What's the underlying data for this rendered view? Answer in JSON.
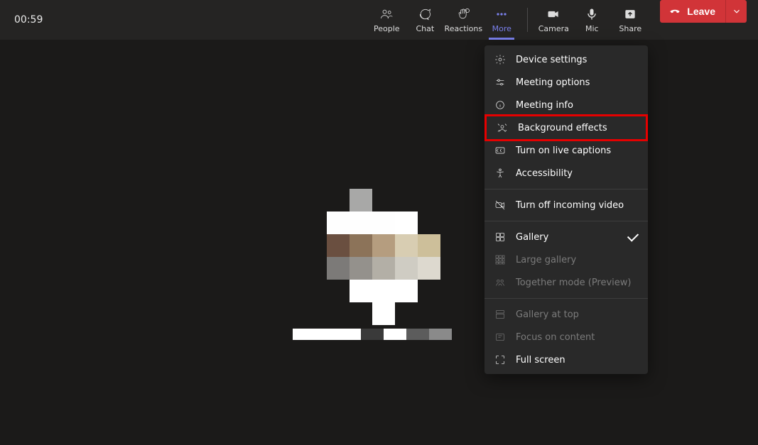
{
  "timer": "00:59",
  "toolbar": {
    "people": "People",
    "chat": "Chat",
    "reactions": "Reactions",
    "more": "More",
    "camera": "Camera",
    "mic": "Mic",
    "share": "Share"
  },
  "leave": {
    "label": "Leave"
  },
  "menu": {
    "device_settings": "Device settings",
    "meeting_options": "Meeting options",
    "meeting_info": "Meeting info",
    "background_effects": "Background effects",
    "live_captions": "Turn on live captions",
    "accessibility": "Accessibility",
    "incoming_video_off": "Turn off incoming video",
    "gallery": "Gallery",
    "large_gallery": "Large gallery",
    "together_mode": "Together mode (Preview)",
    "gallery_at_top": "Gallery at top",
    "focus_on_content": "Focus on content",
    "full_screen": "Full screen"
  }
}
